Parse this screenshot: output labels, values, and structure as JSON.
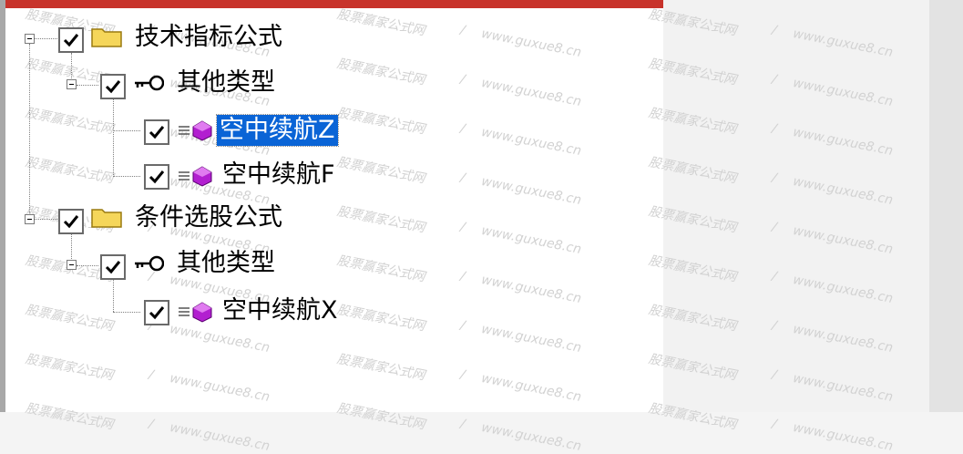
{
  "tree": {
    "nodes": [
      {
        "label": "技术指标公式",
        "checked": true,
        "expanded": true,
        "icon": "folder-icon",
        "level": 0
      },
      {
        "label": "其他类型",
        "checked": true,
        "expanded": true,
        "icon": "key-icon",
        "level": 1
      },
      {
        "label": "空中续航Z",
        "checked": true,
        "selected": true,
        "icon": "formula-icon",
        "level": 2
      },
      {
        "label": "空中续航F",
        "checked": true,
        "icon": "formula-icon",
        "level": 2
      },
      {
        "label": "条件选股公式",
        "checked": true,
        "expanded": true,
        "icon": "folder-icon",
        "level": 0
      },
      {
        "label": "其他类型",
        "checked": true,
        "expanded": true,
        "icon": "key-icon",
        "level": 1
      },
      {
        "label": "空中续航X",
        "checked": true,
        "icon": "formula-icon",
        "level": 2
      }
    ]
  },
  "watermark": {
    "text_cn": "股票赢家公式网",
    "text_sep": "/",
    "text_url": "www.guxue8.cn"
  },
  "colors": {
    "accent_bar": "#c8332b",
    "selection": "#0a64d6",
    "folder": "#e8c24a",
    "formula": "#a020c0"
  }
}
